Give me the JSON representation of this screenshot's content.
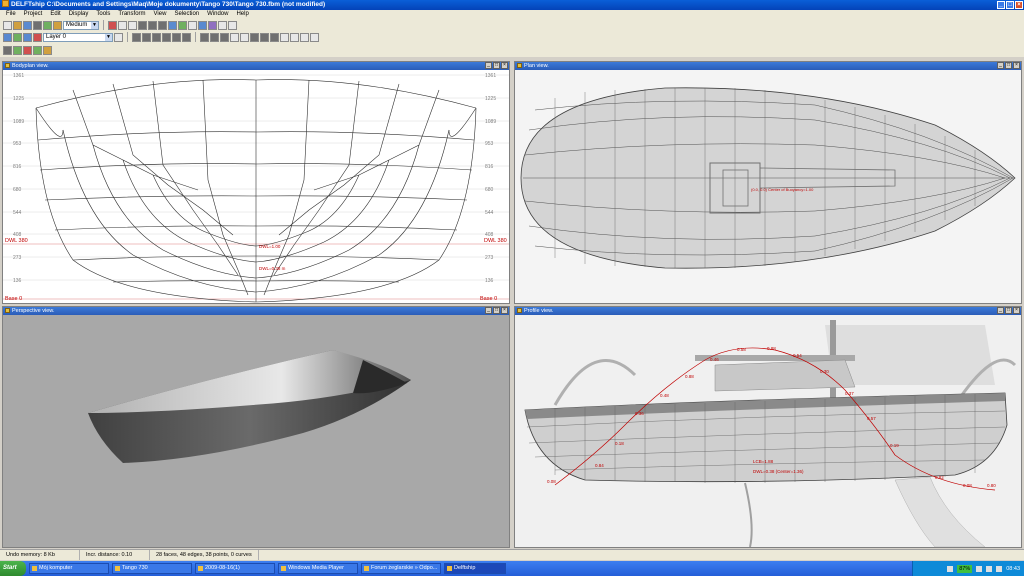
{
  "window": {
    "title": "DELFTship C:\\Documents and Settings\\Maq\\Moje dokumenty\\Tango 730\\Tango 730.fbm (not modified)"
  },
  "menu": [
    "File",
    "Project",
    "Edit",
    "Display",
    "Tools",
    "Transform",
    "View",
    "Selection",
    "Window",
    "Help"
  ],
  "toolbar": {
    "precision_value": "Medium",
    "layer_value": "Layer 0"
  },
  "viewports": {
    "bodyplan": {
      "title": "Bodyplan view.",
      "y_labels": [
        "1361",
        "1225",
        "1089",
        "953",
        "816",
        "680",
        "544",
        "408",
        "273",
        "136"
      ],
      "dwl_label": "DWL 380",
      "base_label": "Base 0",
      "center_label_1": "DWL=1.00",
      "center_label_2": "DWL=0.38 m"
    },
    "plan": {
      "title": "Plan view.",
      "center_label": "(0.0, 0.0) Center of Buoyancy=1.00"
    },
    "perspective": {
      "title": "Perspective view."
    },
    "profile": {
      "title": "Profile view.",
      "curve_labels": [
        "0.08",
        "0.84",
        "0.18",
        "0.36",
        "0.48",
        "0.88",
        "0.46",
        "0.58",
        "0.88",
        "0.54",
        "0.30",
        "0.37",
        "0.57",
        "0.19",
        "0.82",
        "0.08",
        "0.80"
      ],
      "center_label_1": "LCB=1.88",
      "center_label_2": "DWL=0.38 (Center=1.36)"
    }
  },
  "status": {
    "undo": "Undo memory: 8 Kb",
    "curvature": "Incr. distance: 0.10",
    "counts": "28 faces, 48 edges, 38 points, 0 curves"
  },
  "taskbar": {
    "start": "Start",
    "tasks": [
      "Mój komputer",
      "Tango 730",
      "2009-08-16(1)",
      "Windows Media Player",
      "Forum żeglarskie » Odpo...",
      "Delftship"
    ],
    "battery": "87%",
    "clock": "08:43"
  },
  "colors": {
    "accent_red": "#c00000",
    "title_blue": "#0a5fd8"
  }
}
